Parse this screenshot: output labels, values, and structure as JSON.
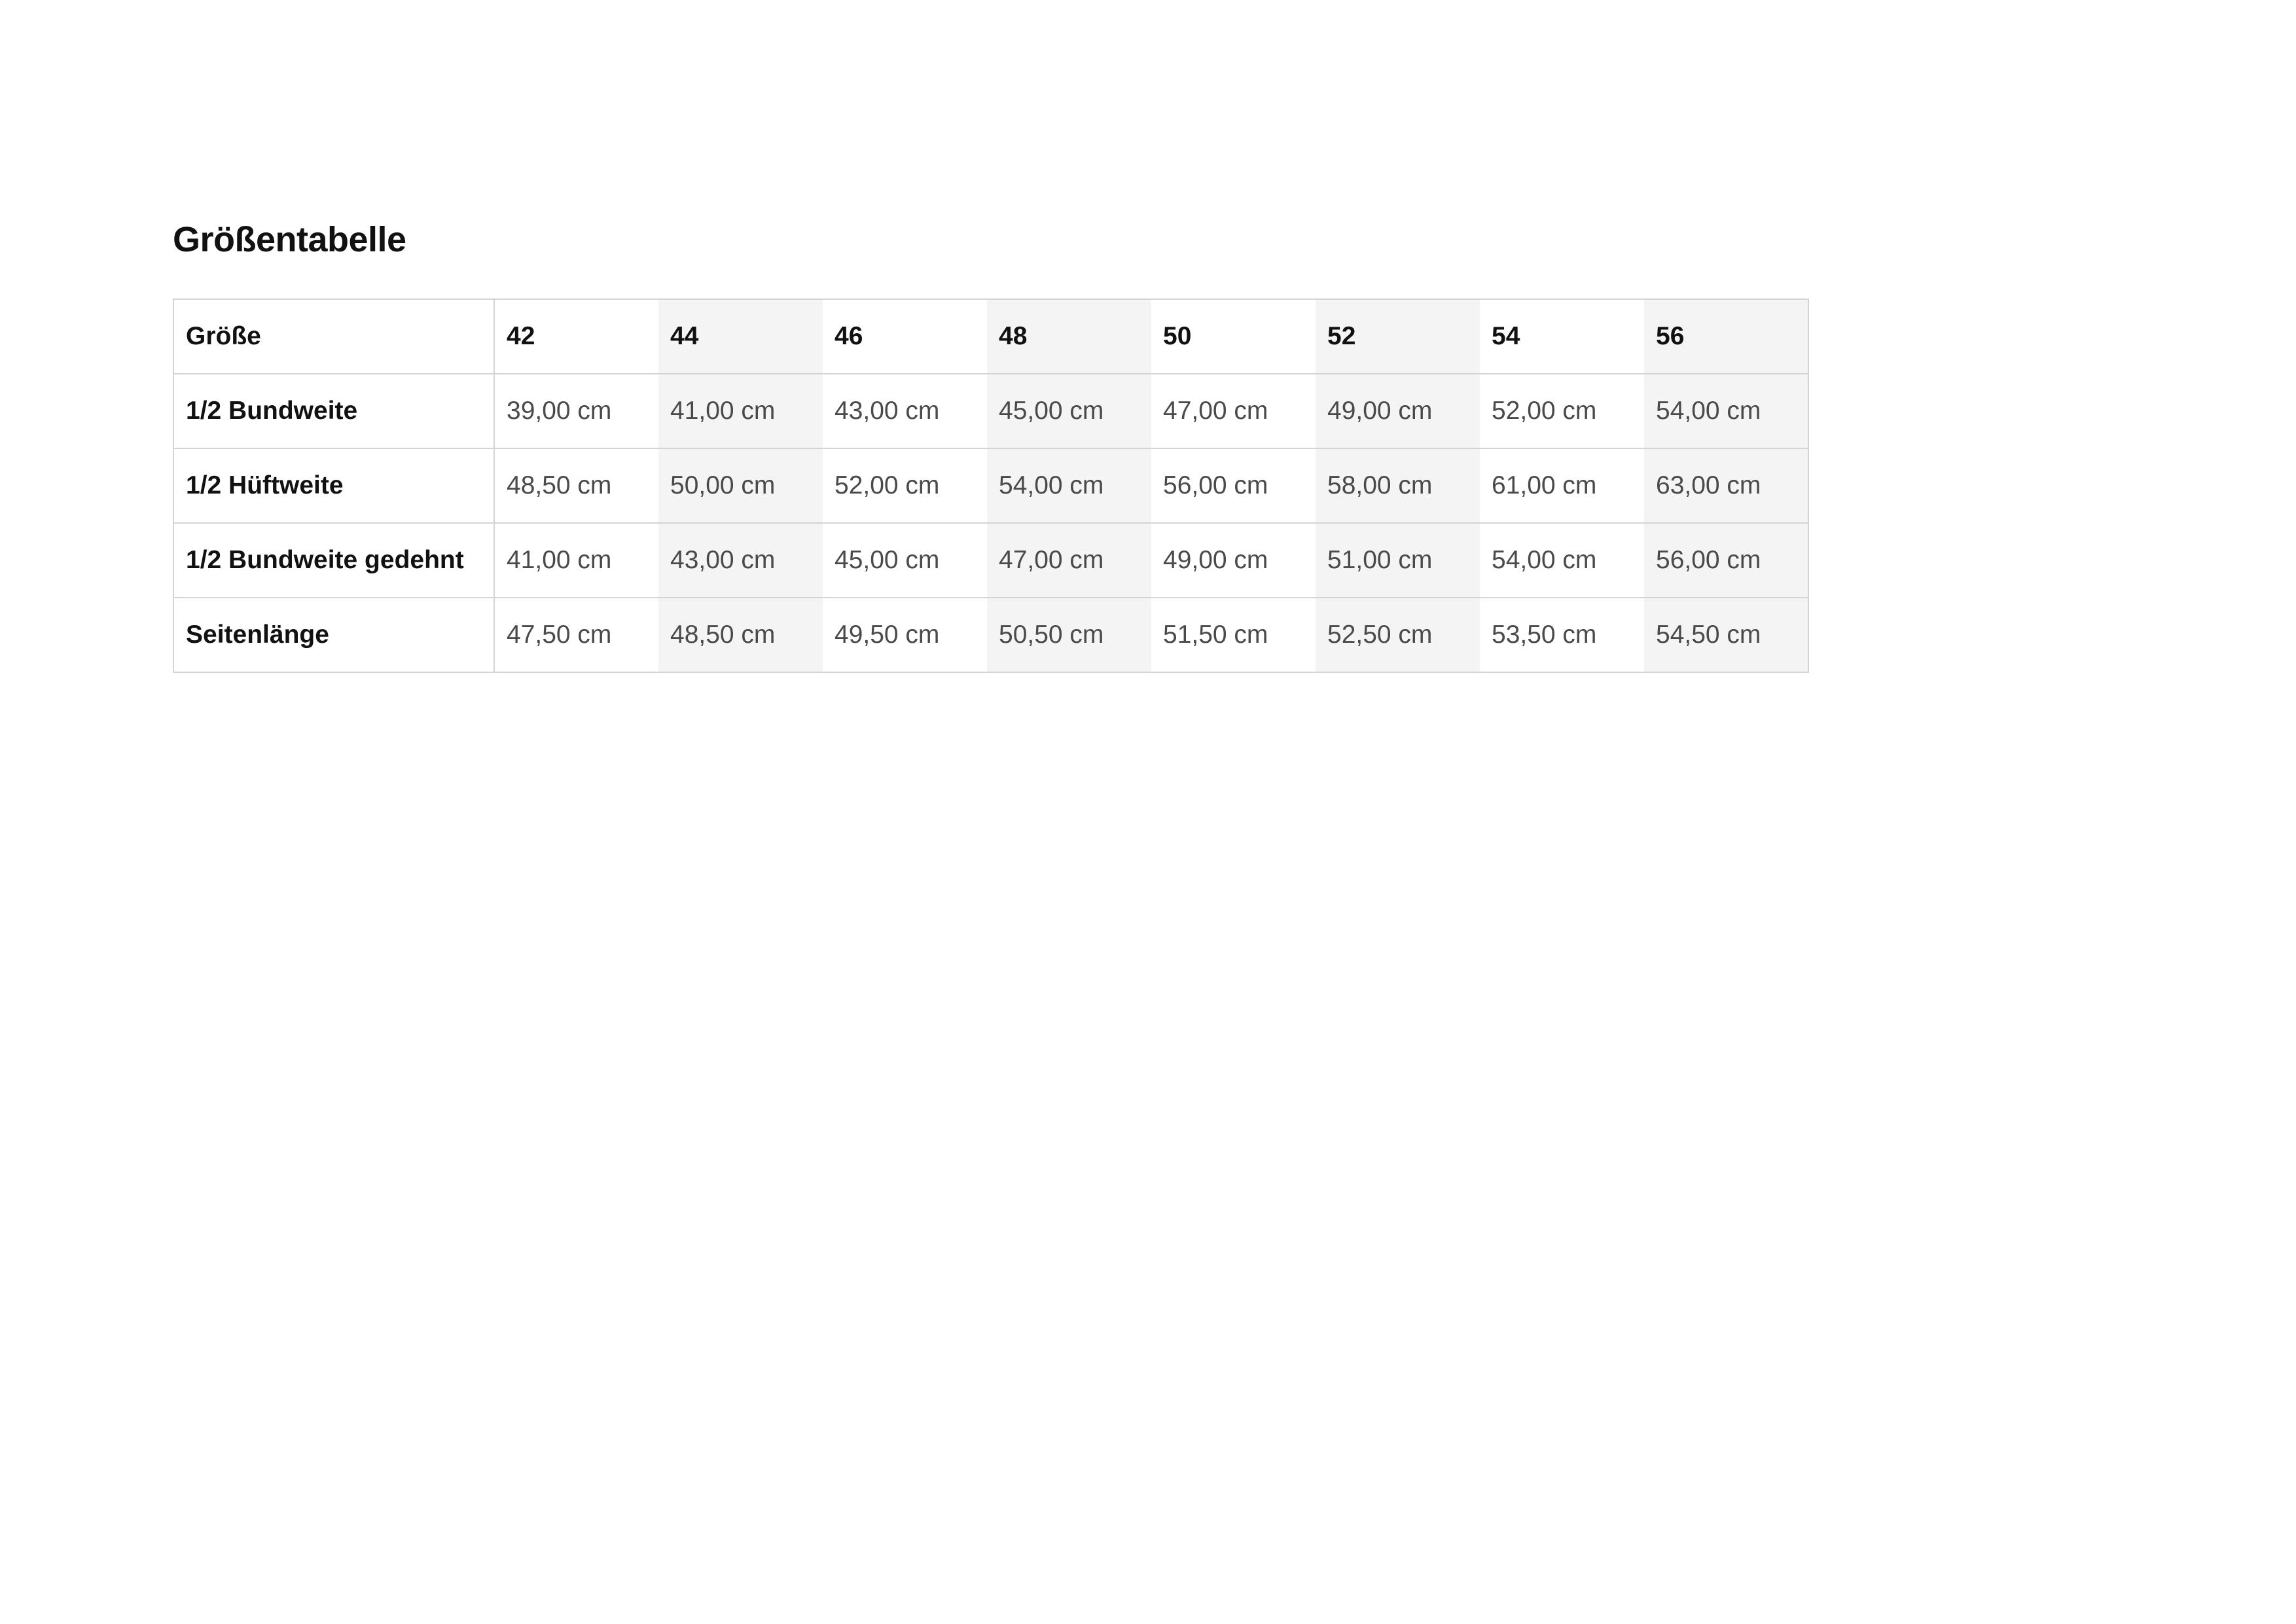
{
  "title": "Größentabelle",
  "table": {
    "corner": "Größe",
    "sizes": [
      "42",
      "44",
      "46",
      "48",
      "50",
      "52",
      "54",
      "56"
    ],
    "rows": [
      {
        "label": "1/2 Bundweite",
        "values": [
          "39,00 cm",
          "41,00 cm",
          "43,00 cm",
          "45,00 cm",
          "47,00 cm",
          "49,00 cm",
          "52,00 cm",
          "54,00 cm"
        ]
      },
      {
        "label": "1/2 Hüftweite",
        "values": [
          "48,50 cm",
          "50,00 cm",
          "52,00 cm",
          "54,00 cm",
          "56,00 cm",
          "58,00 cm",
          "61,00 cm",
          "63,00 cm"
        ]
      },
      {
        "label": "1/2 Bundweite gedehnt",
        "values": [
          "41,00 cm",
          "43,00 cm",
          "45,00 cm",
          "47,00 cm",
          "49,00 cm",
          "51,00 cm",
          "54,00 cm",
          "56,00 cm"
        ]
      },
      {
        "label": "Seitenlänge",
        "values": [
          "47,50 cm",
          "48,50 cm",
          "49,50 cm",
          "50,50 cm",
          "51,50 cm",
          "52,50 cm",
          "53,50 cm",
          "54,50 cm"
        ]
      }
    ]
  },
  "colors": {
    "border": "#d4d4d4",
    "shade": "#f4f4f4",
    "heading_text": "#111111",
    "value_text": "#4a4a4a"
  }
}
